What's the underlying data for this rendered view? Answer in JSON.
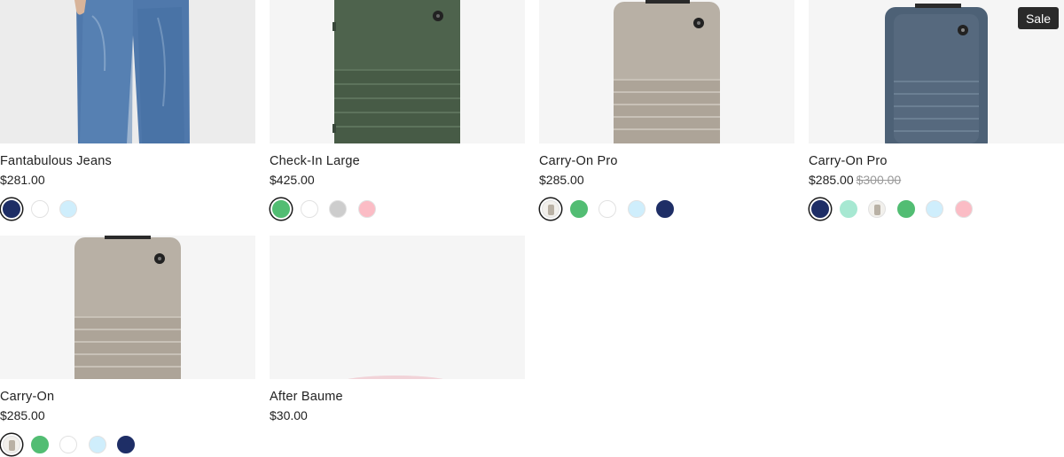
{
  "products": [
    {
      "title": "Fantabulous Jeans",
      "price": "$281.00",
      "swatches": [
        "#1e2e66",
        "#ffffff",
        "#cfeefc"
      ]
    },
    {
      "title": "Check-In Large",
      "price": "$425.00",
      "swatches": [
        "#52bd73",
        "#ffffff",
        "#cdcdcd",
        "#fbbcc5"
      ]
    },
    {
      "title": "Carry-On Pro",
      "price": "$285.00",
      "swatches": [
        "image",
        "#52bd73",
        "#ffffff",
        "#cfeefc",
        "#1e2e66"
      ]
    },
    {
      "title": "Carry-On Pro",
      "price": "$285.00",
      "compare_price": "$300.00",
      "badge": "Sale",
      "swatches": [
        "#1e2e66",
        "#a7e8d2",
        "image",
        "#52bd73",
        "#cfeefc",
        "#fbbcc5"
      ]
    },
    {
      "title": "Carry-On",
      "price": "$285.00",
      "swatches": [
        "image",
        "#52bd73",
        "#ffffff",
        "#cfeefc",
        "#1e2e66"
      ]
    },
    {
      "title": "After Baume",
      "price": "$30.00",
      "swatches": []
    }
  ]
}
